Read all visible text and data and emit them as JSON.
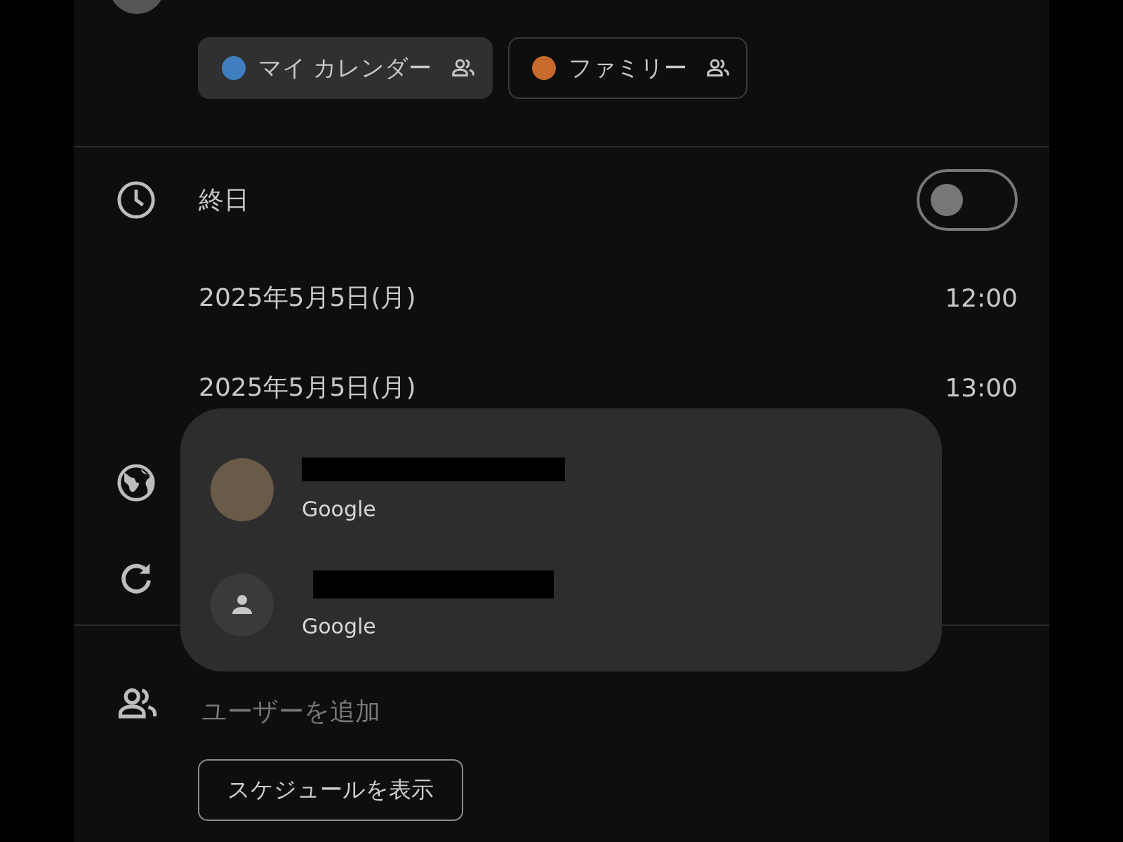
{
  "calendars": [
    {
      "label": "マイ カレンダー",
      "color": "#3f7fbf",
      "selected": true
    },
    {
      "label": "ファミリー",
      "color": "#c86a2c",
      "selected": false
    }
  ],
  "all_day": {
    "label": "終日",
    "on": false
  },
  "times": [
    {
      "date": "2025年5月5日(月)",
      "time": "12:00"
    },
    {
      "date": "2025年5月5日(月)",
      "time": "13:00"
    }
  ],
  "add_people": {
    "placeholder": "ユーザーを追加"
  },
  "schedule_button": "スケジュールを表示",
  "account_menu": [
    {
      "kind": "photo",
      "provider": "Google"
    },
    {
      "kind": "default",
      "provider": "Google"
    }
  ]
}
